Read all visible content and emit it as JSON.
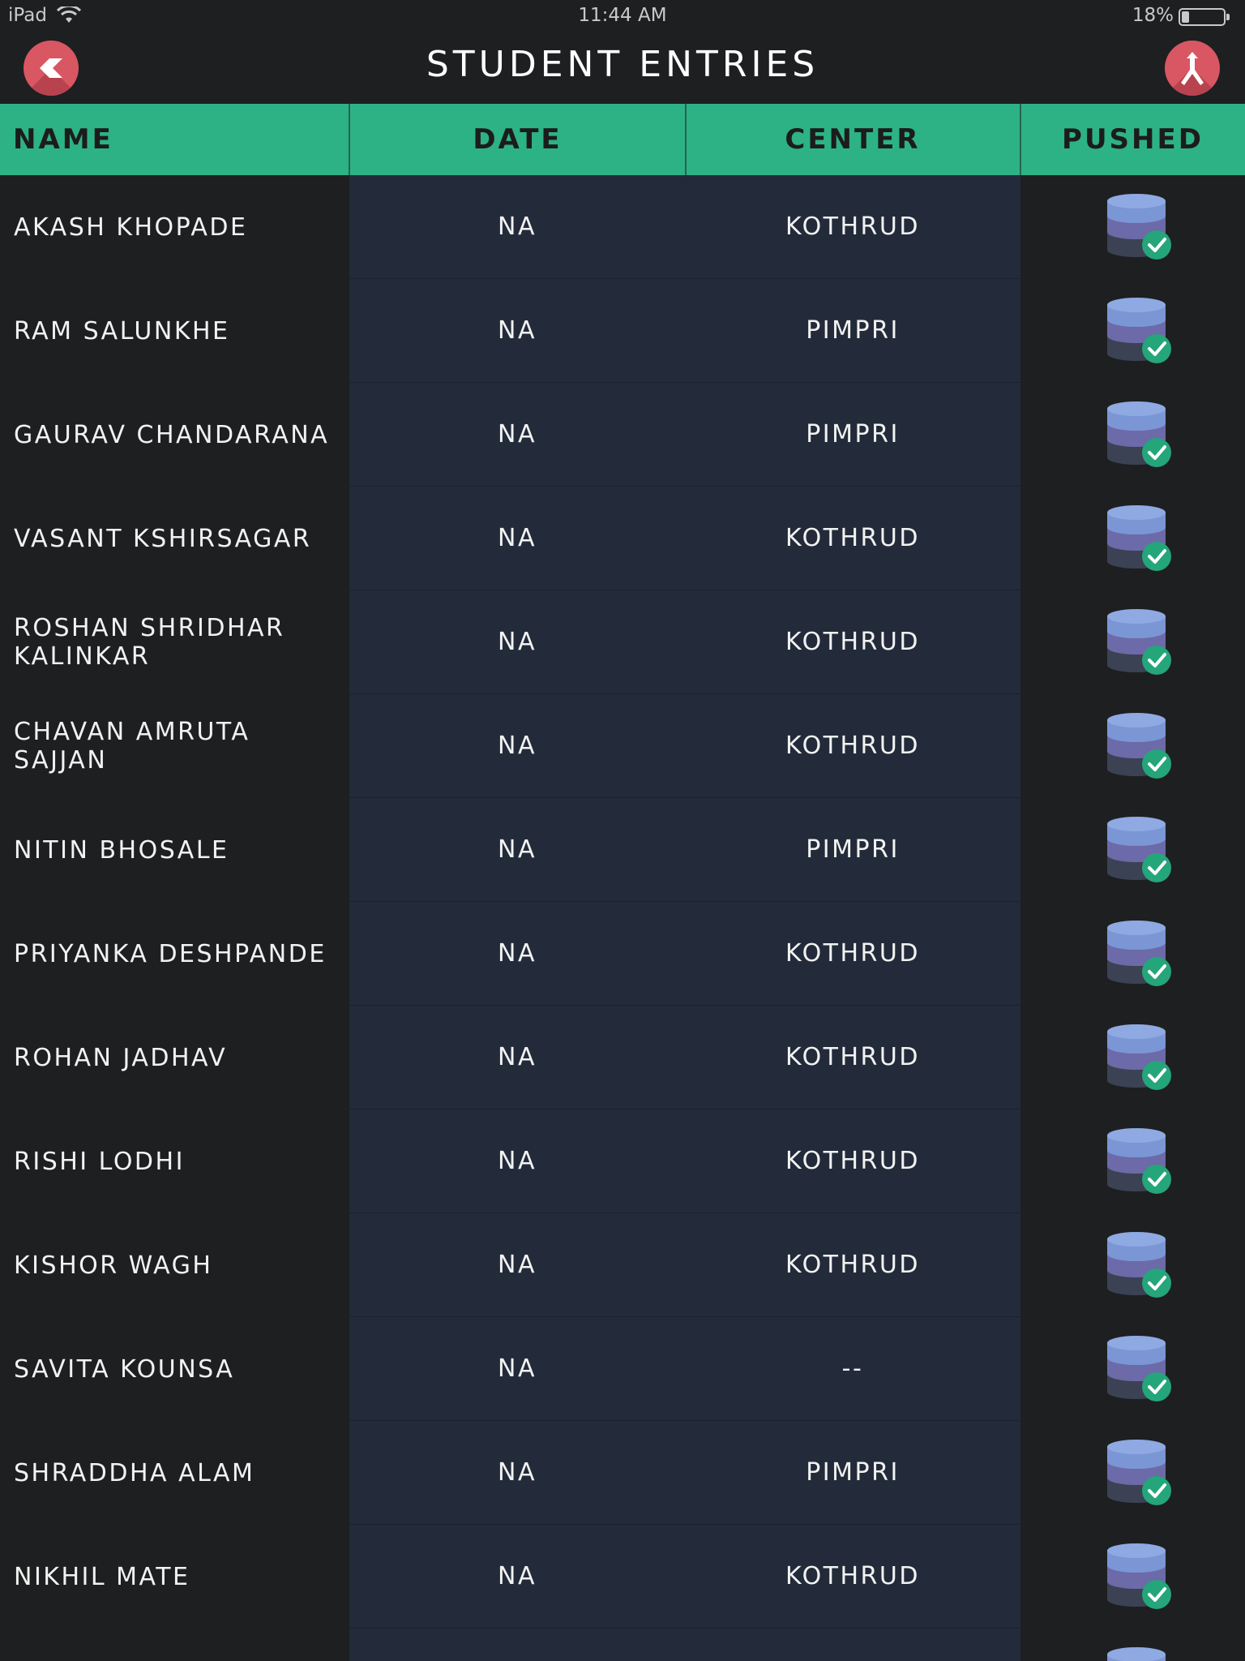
{
  "status_bar": {
    "device": "iPad",
    "time": "11:44 AM",
    "battery_percent": "18%",
    "battery_level": 0.18
  },
  "nav": {
    "title": "STUDENT ENTRIES",
    "back_icon": "chevron-left-icon",
    "merge_icon": "merge-icon"
  },
  "table": {
    "headers": [
      "NAME",
      "DATE",
      "CENTER",
      "PUSHED"
    ],
    "rows": [
      {
        "name": "AKASH KHOPADE",
        "date": "NA",
        "center": "KOTHRUD",
        "pushed": true
      },
      {
        "name": "RAM SALUNKHE",
        "date": "NA",
        "center": "PIMPRI",
        "pushed": true
      },
      {
        "name": "GAURAV CHANDARANA",
        "date": "NA",
        "center": "PIMPRI",
        "pushed": true
      },
      {
        "name": "VASANT KSHIRSAGAR",
        "date": "NA",
        "center": "KOTHRUD",
        "pushed": true
      },
      {
        "name": "ROSHAN SHRIDHAR KALINKAR",
        "date": "NA",
        "center": "KOTHRUD",
        "pushed": true
      },
      {
        "name": "CHAVAN AMRUTA SAJJAN",
        "date": "NA",
        "center": "KOTHRUD",
        "pushed": true
      },
      {
        "name": "NITIN BHOSALE",
        "date": "NA",
        "center": "PIMPRI",
        "pushed": true
      },
      {
        "name": "PRIYANKA DESHPANDE",
        "date": "NA",
        "center": "KOTHRUD",
        "pushed": true
      },
      {
        "name": "ROHAN JADHAV",
        "date": "NA",
        "center": "KOTHRUD",
        "pushed": true
      },
      {
        "name": "RISHI LODHI",
        "date": "NA",
        "center": "KOTHRUD",
        "pushed": true
      },
      {
        "name": "KISHOR WAGH",
        "date": "NA",
        "center": "KOTHRUD",
        "pushed": true
      },
      {
        "name": "SAVITA KOUNSA",
        "date": "NA",
        "center": "--",
        "pushed": true
      },
      {
        "name": "SHRADDHA ALAM",
        "date": "NA",
        "center": "PIMPRI",
        "pushed": true
      },
      {
        "name": "NIKHIL MATE",
        "date": "NA",
        "center": "KOTHRUD",
        "pushed": true
      },
      {
        "name": "",
        "date": "",
        "center": "",
        "pushed": true
      }
    ]
  },
  "colors": {
    "accent_green": "#2db286",
    "button_red": "#d95663",
    "background": "#1e1f21",
    "middle_columns": "#232b3a",
    "db_blue": "#7b96d4",
    "db_purple": "#6c6aa8",
    "db_dark": "#3b4254",
    "check_green": "#25a57a"
  }
}
